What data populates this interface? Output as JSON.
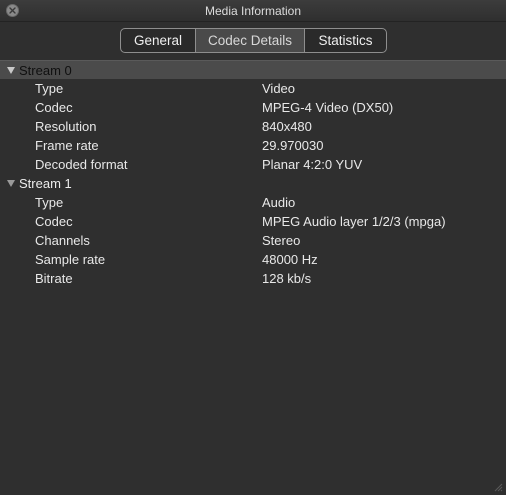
{
  "window": {
    "title": "Media Information"
  },
  "tabs": [
    {
      "label": "General",
      "selected": false
    },
    {
      "label": "Codec Details",
      "selected": true
    },
    {
      "label": "Statistics",
      "selected": false
    }
  ],
  "streams": [
    {
      "header": "Stream 0",
      "rows": [
        {
          "key": "Type",
          "value": "Video"
        },
        {
          "key": "Codec",
          "value": "MPEG-4 Video (DX50)"
        },
        {
          "key": "Resolution",
          "value": "840x480"
        },
        {
          "key": "Frame rate",
          "value": "29.970030"
        },
        {
          "key": "Decoded format",
          "value": "Planar 4:2:0 YUV"
        }
      ]
    },
    {
      "header": "Stream 1",
      "rows": [
        {
          "key": "Type",
          "value": "Audio"
        },
        {
          "key": "Codec",
          "value": "MPEG Audio layer 1/2/3 (mpga)"
        },
        {
          "key": "Channels",
          "value": "Stereo"
        },
        {
          "key": "Sample rate",
          "value": "48000 Hz"
        },
        {
          "key": "Bitrate",
          "value": "128 kb/s"
        }
      ]
    }
  ]
}
